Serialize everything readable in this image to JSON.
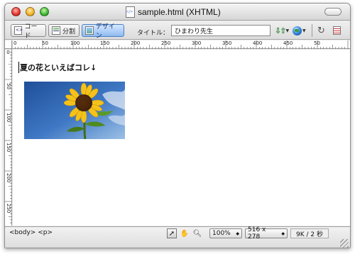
{
  "window": {
    "title": "sample.html (XHTML)"
  },
  "toolbar": {
    "code_label": "コード",
    "split_label": "分割",
    "design_label": "デザイン",
    "title_label": "タイトル：",
    "title_value": "ひまわり先生",
    "icons": [
      "code-view-icon",
      "split-view-icon",
      "design-view-icon",
      "file-transfer-icon",
      "preview-globe-icon",
      "refresh-icon",
      "view-options-icon"
    ]
  },
  "ruler": {
    "top": [
      "0",
      "50",
      "100",
      "150",
      "200",
      "250",
      "300",
      "350",
      "400",
      "450",
      "50"
    ],
    "left": [
      "0",
      "50",
      "100",
      "150",
      "200",
      "250"
    ]
  },
  "content": {
    "heading": "夏の花といえばコレ↓",
    "image_description": "sunflower"
  },
  "status": {
    "tag_selector": "<body> <p>",
    "zoom": "100%",
    "window_size": "516 x 278",
    "file_stats": "9K / 2 秒"
  },
  "colors": {
    "design_active": "#8fbaf0",
    "window_chrome": "#e9e9e9"
  }
}
